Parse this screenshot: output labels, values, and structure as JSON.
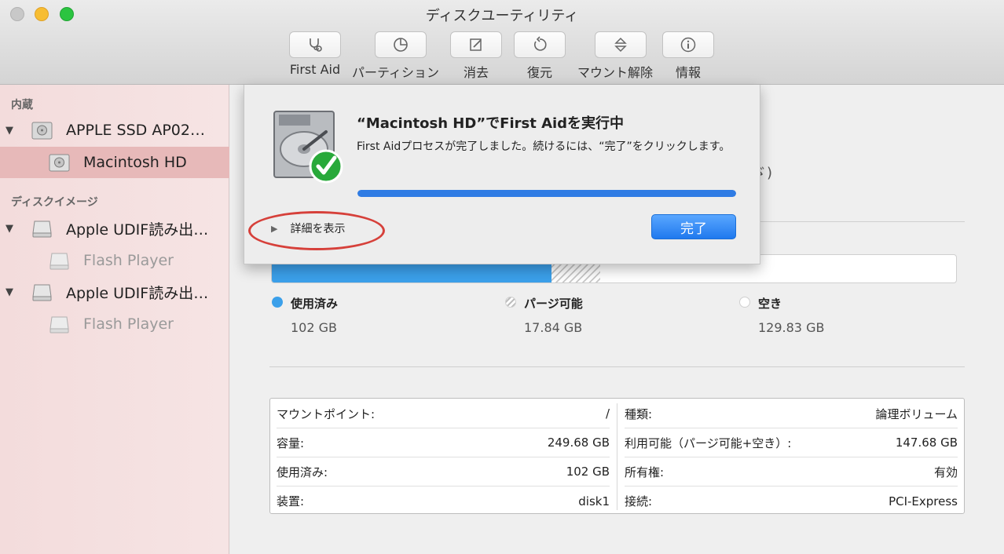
{
  "window": {
    "title": "ディスクユーティリティ"
  },
  "toolbar": {
    "items": [
      {
        "label": "First Aid",
        "icon": "stethoscope-icon"
      },
      {
        "label": "パーティション",
        "icon": "pie-chart-icon"
      },
      {
        "label": "消去",
        "icon": "pencil-icon"
      },
      {
        "label": "復元",
        "icon": "restore-icon"
      },
      {
        "label": "マウント解除",
        "icon": "eject-icon"
      },
      {
        "label": "情報",
        "icon": "info-icon"
      }
    ]
  },
  "sidebar": {
    "internal_title": "内蔵",
    "disk_images_title": "ディスクイメージ",
    "items": [
      {
        "label": "APPLE SSD AP02…"
      },
      {
        "label": "Macintosh HD"
      },
      {
        "label": "Apple UDIF読み出…"
      },
      {
        "label": "Flash Player"
      },
      {
        "label": "Apple UDIF読み出…"
      },
      {
        "label": "Flash Player"
      }
    ]
  },
  "main": {
    "partial_text": "ゞ)",
    "usage": {
      "used_fraction": 0.4085,
      "purgeable_fraction": 0.0714,
      "legend": [
        {
          "name": "使用済み",
          "value": "102 GB",
          "color": "#3ba0ea"
        },
        {
          "name": "パージ可能",
          "value": "17.84 GB",
          "color": "#cccccc"
        },
        {
          "name": "空き",
          "value": "129.83 GB",
          "color": "#ffffff"
        }
      ]
    },
    "info": {
      "left": [
        {
          "label": "マウントポイント:",
          "value": "/"
        },
        {
          "label": "容量:",
          "value": "249.68 GB"
        },
        {
          "label": "使用済み:",
          "value": "102 GB"
        },
        {
          "label": "装置:",
          "value": "disk1"
        }
      ],
      "right": [
        {
          "label": "種類:",
          "value": "論理ボリューム"
        },
        {
          "label": "利用可能（パージ可能+空き）:",
          "value": "147.68 GB"
        },
        {
          "label": "所有権:",
          "value": "有効"
        },
        {
          "label": "接続:",
          "value": "PCI-Express"
        }
      ]
    }
  },
  "dialog": {
    "title": "“Macintosh HD”でFirst Aidを実行中",
    "message": "First Aidプロセスが完了しました。続けるには、“完了”をクリックします。",
    "progress": 1.0,
    "details_label": "詳細を表示",
    "done_label": "完了"
  },
  "colors": {
    "accent": "#2f7ce4",
    "highlight": "#d6403a",
    "sidebar_selected": "#e7b9b9"
  }
}
